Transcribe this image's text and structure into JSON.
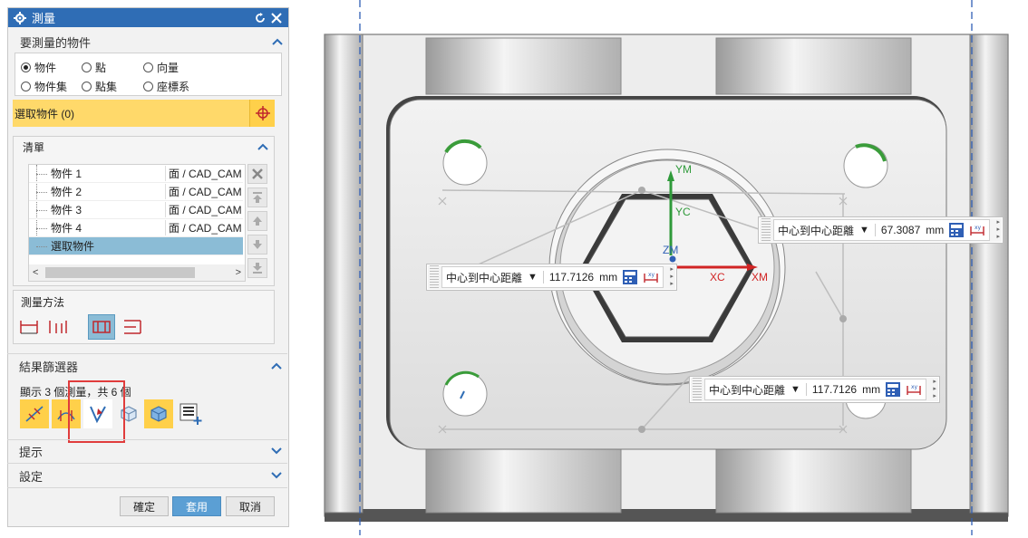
{
  "dialog": {
    "title": "測量",
    "sections": {
      "objects": {
        "label": "要測量的物件",
        "radios": [
          {
            "label": "物件",
            "checked": true
          },
          {
            "label": "點",
            "checked": false
          },
          {
            "label": "向量",
            "checked": false
          },
          {
            "label": "物件集",
            "checked": false
          },
          {
            "label": "點集",
            "checked": false
          },
          {
            "label": "座標系",
            "checked": false
          }
        ],
        "select_label": "選取物件 (0)"
      },
      "list": {
        "label": "清單",
        "rows": [
          {
            "name": "物件 1",
            "type": "面 / CAD_CAM"
          },
          {
            "name": "物件 2",
            "type": "面 / CAD_CAM"
          },
          {
            "name": "物件 3",
            "type": "面 / CAD_CAM"
          },
          {
            "name": "物件 4",
            "type": "面 / CAD_CAM"
          },
          {
            "name": "選取物件",
            "type": ""
          }
        ]
      },
      "method": {
        "label": "測量方法"
      },
      "filter": {
        "label": "結果篩選器",
        "summary": "顯示 3 個測量，共 6 個"
      },
      "hints": {
        "label": "提示"
      },
      "settings": {
        "label": "設定"
      }
    },
    "buttons": {
      "ok": "確定",
      "apply": "套用",
      "cancel": "取消"
    }
  },
  "viewport": {
    "axes": {
      "ym": "YM",
      "yc": "YC",
      "zm": "ZM",
      "xc": "XC",
      "xm": "XM"
    },
    "callouts": [
      {
        "label": "中心到中心距離",
        "dropdown": "▼",
        "value": "67.3087",
        "unit": "mm"
      },
      {
        "label": "中心到中心距離",
        "dropdown": "▼",
        "value": "117.7126",
        "unit": "mm"
      },
      {
        "label": "中心到中心距離",
        "dropdown": "▼",
        "value": "117.7126",
        "unit": "mm"
      }
    ]
  },
  "colors": {
    "accent": "#2f6db5",
    "selection": "#ffd96a",
    "highlight": "#8bbcd6",
    "annotation_red": "#e03c3c"
  }
}
